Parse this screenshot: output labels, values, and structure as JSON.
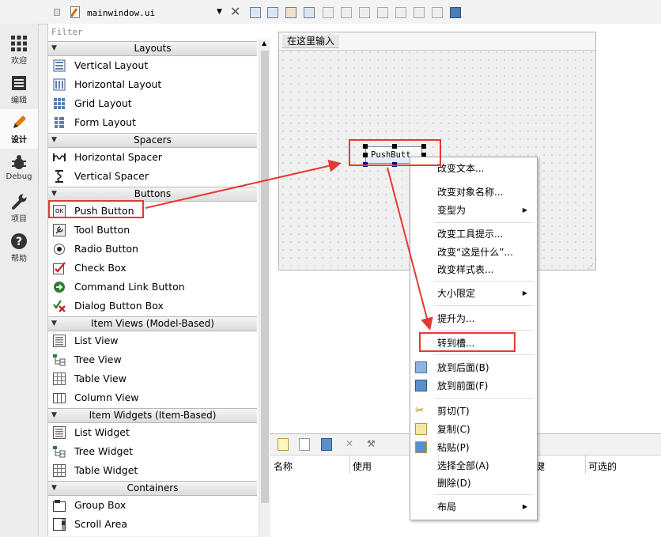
{
  "toolbar": {
    "filename": "mainwindow.ui"
  },
  "modes": [
    {
      "label": "欢迎",
      "icon": "grid-icon"
    },
    {
      "label": "编辑",
      "icon": "document-icon"
    },
    {
      "label": "设计",
      "icon": "pencil-icon"
    },
    {
      "label": "Debug",
      "icon": "bug-icon"
    },
    {
      "label": "项目",
      "icon": "wrench-icon"
    },
    {
      "label": "帮助",
      "icon": "help-icon"
    }
  ],
  "widgetbox": {
    "filter_placeholder": "Filter",
    "categories": {
      "layouts": "Layouts",
      "spacers": "Spacers",
      "buttons": "Buttons",
      "item_views": "Item Views (Model-Based)",
      "item_widgets": "Item Widgets (Item-Based)",
      "containers": "Containers"
    },
    "items": {
      "vertical_layout": "Vertical Layout",
      "horizontal_layout": "Horizontal Layout",
      "grid_layout": "Grid Layout",
      "form_layout": "Form Layout",
      "horizontal_spacer": "Horizontal Spacer",
      "vertical_spacer": "Vertical Spacer",
      "push_button": "Push Button",
      "tool_button": "Tool Button",
      "radio_button": "Radio Button",
      "check_box": "Check Box",
      "command_link_button": "Command Link Button",
      "dialog_button_box": "Dialog Button Box",
      "list_view": "List View",
      "tree_view": "Tree View",
      "table_view": "Table View",
      "column_view": "Column View",
      "list_widget": "List Widget",
      "tree_widget": "Tree Widget",
      "table_widget": "Table Widget",
      "group_box": "Group Box",
      "scroll_area": "Scroll Area"
    },
    "ok_icon_text": "OK"
  },
  "form": {
    "menu_placeholder": "在这里输入",
    "pushbutton_text": "PushButt"
  },
  "context_menu": {
    "change_text": "改变文本...",
    "change_object_name": "改变对象名称...",
    "morph_into": "变型为",
    "change_tooltip": "改变工具提示...",
    "change_whats_this": "改变“这是什么”...",
    "change_stylesheet": "改变样式表...",
    "size_constraints": "大小限定",
    "promote_to": "提升为...",
    "go_to_slot": "转到槽...",
    "send_to_back": "放到后面(B)",
    "bring_to_front": "放到前面(F)",
    "cut": "剪切(T)",
    "copy": "复制(C)",
    "paste": "粘贴(P)",
    "select_all": "选择全部(A)",
    "delete": "删除(D)",
    "layout": "布局"
  },
  "signal_panel": {
    "columns": [
      "名称",
      "使用",
      "键",
      "可选的"
    ]
  },
  "colors": {
    "annotation": "#e53935",
    "selection": "#000080"
  }
}
